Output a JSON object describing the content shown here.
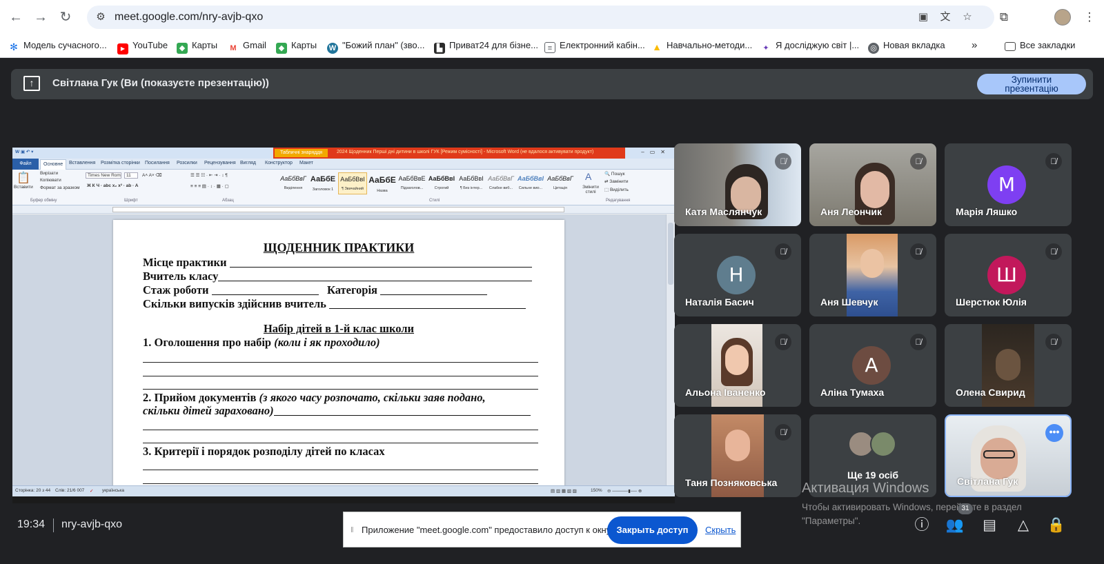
{
  "browser": {
    "url": "meet.google.com/nry-avjb-qxo",
    "bookmarks": [
      {
        "label": "Модель сучасного...",
        "icon": "snowflake-icon",
        "color": "#1a73e8"
      },
      {
        "label": "YouTube",
        "icon": "youtube-icon",
        "color": "#ff0000"
      },
      {
        "label": "Карты",
        "icon": "maps-icon",
        "color": "#34a853"
      },
      {
        "label": "Gmail",
        "icon": "gmail-icon",
        "color": "#ea4335"
      },
      {
        "label": "Карты",
        "icon": "maps-icon",
        "color": "#34a853"
      },
      {
        "label": "\"Божий план\" (зво...",
        "icon": "wordpress-icon",
        "color": "#21759b"
      },
      {
        "label": "Приват24 для бізне...",
        "icon": "privat24-icon",
        "color": "#2b2b2b"
      },
      {
        "label": "Електронний кабін...",
        "icon": "document-icon",
        "color": "#5f6368"
      },
      {
        "label": "Навчально-методи...",
        "icon": "google-drive-icon",
        "color": "#fbbc04"
      },
      {
        "label": "Я досліджую світ |...",
        "icon": "site-icon",
        "color": "#673ab7"
      },
      {
        "label": "Новая вкладка",
        "icon": "globe-icon",
        "color": "#5f6368"
      }
    ],
    "all_bookmarks": "Все закладки"
  },
  "presenting": {
    "text": "Світлана Гук (Ви (показуєте презентацію))",
    "stop_line1": "Зупинити",
    "stop_line2": "презентацію"
  },
  "word": {
    "contextual_tab": "Табличні знаряддя",
    "title": "2024 Щоденник Перші дні дитини в школі ГУК [Режим сумісності] - Microsoft Word (не вдалося активувати продукт)",
    "tabs": [
      "Файл",
      "Основне",
      "Вставлення",
      "Розмітка сторінки",
      "Посилання",
      "Розсилки",
      "Рецензування",
      "Вигляд",
      "Конструктор",
      "Макет"
    ],
    "clipboard": {
      "paste": "Вставити",
      "cut": "Вирізати",
      "copy": "Копіювати",
      "format": "Формат за зразком"
    },
    "font_name": "Times New Rom",
    "font_size": "11",
    "styles": [
      {
        "sample": "АаБбВвГ",
        "name": "Виділення"
      },
      {
        "sample": "АаБбЕ",
        "name": "Заголовок 1"
      },
      {
        "sample": "АаБбВвІ",
        "name": "¶ Звичайний"
      },
      {
        "sample": "АаБбЕ",
        "name": "Назва"
      },
      {
        "sample": "АаБбВвЕ",
        "name": "Підзаголов..."
      },
      {
        "sample": "АаБбВвІ",
        "name": "Строгий"
      },
      {
        "sample": "АаБбВвІ",
        "name": "¶ Без інтер..."
      },
      {
        "sample": "АаБбВвГ",
        "name": "Слабке виб..."
      },
      {
        "sample": "АаБбВвІ",
        "name": "Сильне вио..."
      },
      {
        "sample": "АаБбВвГ",
        "name": "Цитація"
      }
    ],
    "change_styles": "Змінити стилі",
    "editing": {
      "find": "Пошук",
      "replace": "Замінити",
      "select": "Виділить"
    },
    "groups": {
      "clipboard": "Буфер обміну",
      "font": "Шрифт",
      "paragraph": "Абзац",
      "styles": "Стилі",
      "editing": "Редагування"
    },
    "status": {
      "page": "Сторінка: 20 з 44",
      "words": "Слів: 21/6 007",
      "lang": "українська",
      "zoom": "150%"
    },
    "document": {
      "title": "ЩОДЕННИК ПРАКТИКИ",
      "line1": "Місце практики",
      "line2": "Вчитель класу",
      "line3": "Стаж роботи",
      "line3b": "Категорія",
      "line4": "Скільки випусків здійснив вчитель",
      "section": "Набір дітей в 1-й клас школи",
      "item1": "1. Оголошення про набір",
      "item1_note": "(коли і як проходило)",
      "item2": "2. Прийом  документів",
      "item2_note": "(з якого часу розпочато, скільки заяв подано,",
      "item2_note2": "скільки дітей зараховано)",
      "item3": "3. Критерії і порядок розподілу дітей по класах"
    }
  },
  "participants": [
    {
      "name": "Катя Маслянчук",
      "type": "video",
      "bg": "#8a8f94"
    },
    {
      "name": "Аня Леончик",
      "type": "video",
      "bg": "#8b8d86"
    },
    {
      "name": "Марія Ляшко",
      "type": "avatar",
      "initial": "M",
      "color": "#7e3ff2"
    },
    {
      "name": "Наталія Басич",
      "type": "avatar",
      "initial": "Н",
      "color": "#5f7d8e"
    },
    {
      "name": "Аня Шевчук",
      "type": "video",
      "bg": "#4a6fa8"
    },
    {
      "name": "Шерстюк Юлія",
      "type": "avatar",
      "initial": "Ш",
      "color": "#c2185b"
    },
    {
      "name": "Альона Іваненко",
      "type": "video",
      "bg": "#d8cfc6"
    },
    {
      "name": "Аліна Тумаха",
      "type": "avatar",
      "initial": "А",
      "color": "#6d4c41"
    },
    {
      "name": "Олена Свирид",
      "type": "video",
      "bg": "#2f2a24"
    },
    {
      "name": "Таня Позняковська",
      "type": "video",
      "bg": "#a8826a"
    },
    {
      "name": "Ще 19 осіб",
      "type": "more"
    },
    {
      "name": "Світлана Гук",
      "type": "self",
      "bg": "#cfd6dd"
    }
  ],
  "watermark": {
    "title": "Активация Windows",
    "line1": "Чтобы активировать Windows, перейдите в раздел",
    "line2": "\"Параметры\"."
  },
  "bottom": {
    "time": "19:34",
    "meeting_code": "nry-avjb-qxo",
    "people_count": "31"
  },
  "share_notice": {
    "message": "Приложение \"meet.google.com\" предоставило доступ к окну.",
    "stop": "Закрыть доступ",
    "hide": "Скрыть"
  }
}
